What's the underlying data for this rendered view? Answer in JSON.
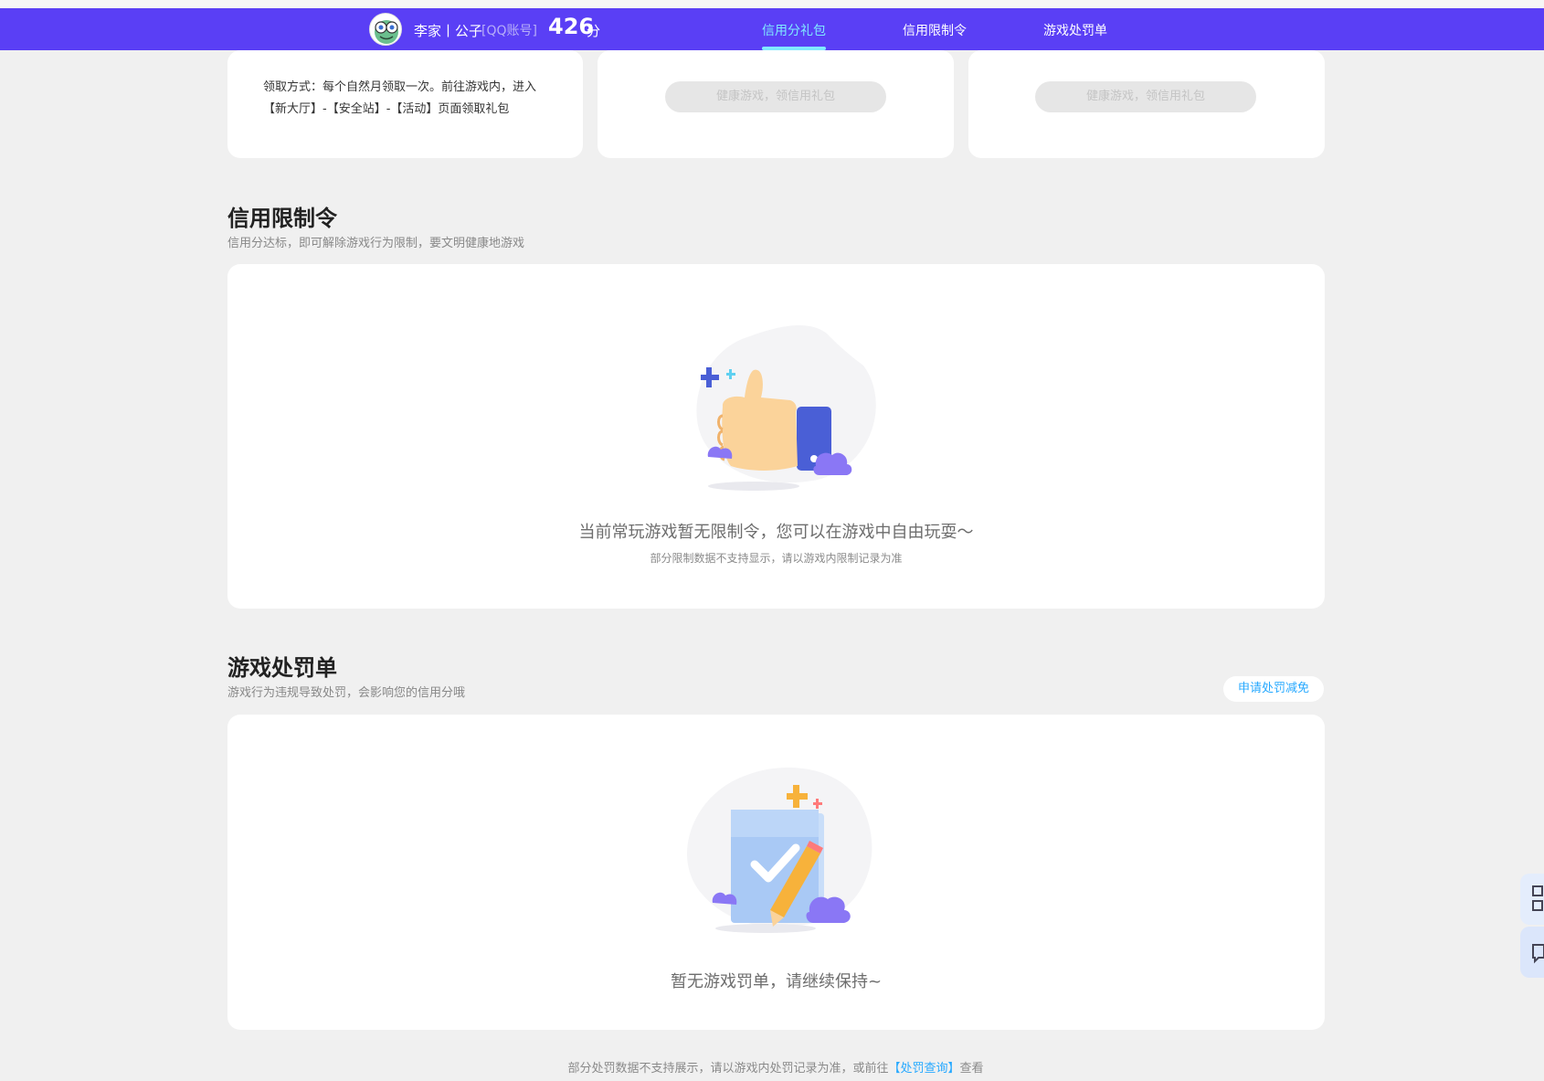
{
  "header": {
    "user_name": "李家丨公子",
    "account_type": "[QQ账号]",
    "score": "426",
    "score_unit": "分",
    "tabs": [
      "信用分礼包",
      "信用限制令",
      "游戏处罚单"
    ],
    "active_tab": "信用分礼包"
  },
  "gift_section": {
    "claim_method": "领取方式：每个自然月领取一次。前往游戏内，进入【新大厅】-【安全站】-【活动】页面领取礼包",
    "buttons": [
      "健康游戏，领信用礼包",
      "健康游戏，领信用礼包"
    ]
  },
  "restriction": {
    "title": "信用限制令",
    "subtitle": "信用分达标，即可解除游戏行为限制，要文明健康地游戏",
    "empty_text": "当前常玩游戏暂无限制令，您可以在游戏中自由玩耍～",
    "empty_note": "部分限制数据不支持显示，请以游戏内限制记录为准",
    "illustration_icon": "thumbs-up-icon"
  },
  "penalty": {
    "title": "游戏处罚单",
    "subtitle": "游戏行为违规导致处罚，会影响您的信用分哦",
    "apply_button": "申请处罚减免",
    "empty_text": "暂无游戏罚单，请继续保持~",
    "illustration_icon": "checklist-pencil-icon"
  },
  "footer": {
    "note_prefix": "部分处罚数据不支持展示，请以游戏内处罚记录为准，或前往",
    "note_link": "【处罚查询】",
    "note_suffix": "查看"
  },
  "side_tools": [
    "qrcode-icon",
    "feedback-icon"
  ],
  "colors": {
    "header_bg": "#5a3ff5",
    "active_tab": "#7fe9ff",
    "link": "#27a9ff",
    "page_bg": "#f0f0f0"
  }
}
